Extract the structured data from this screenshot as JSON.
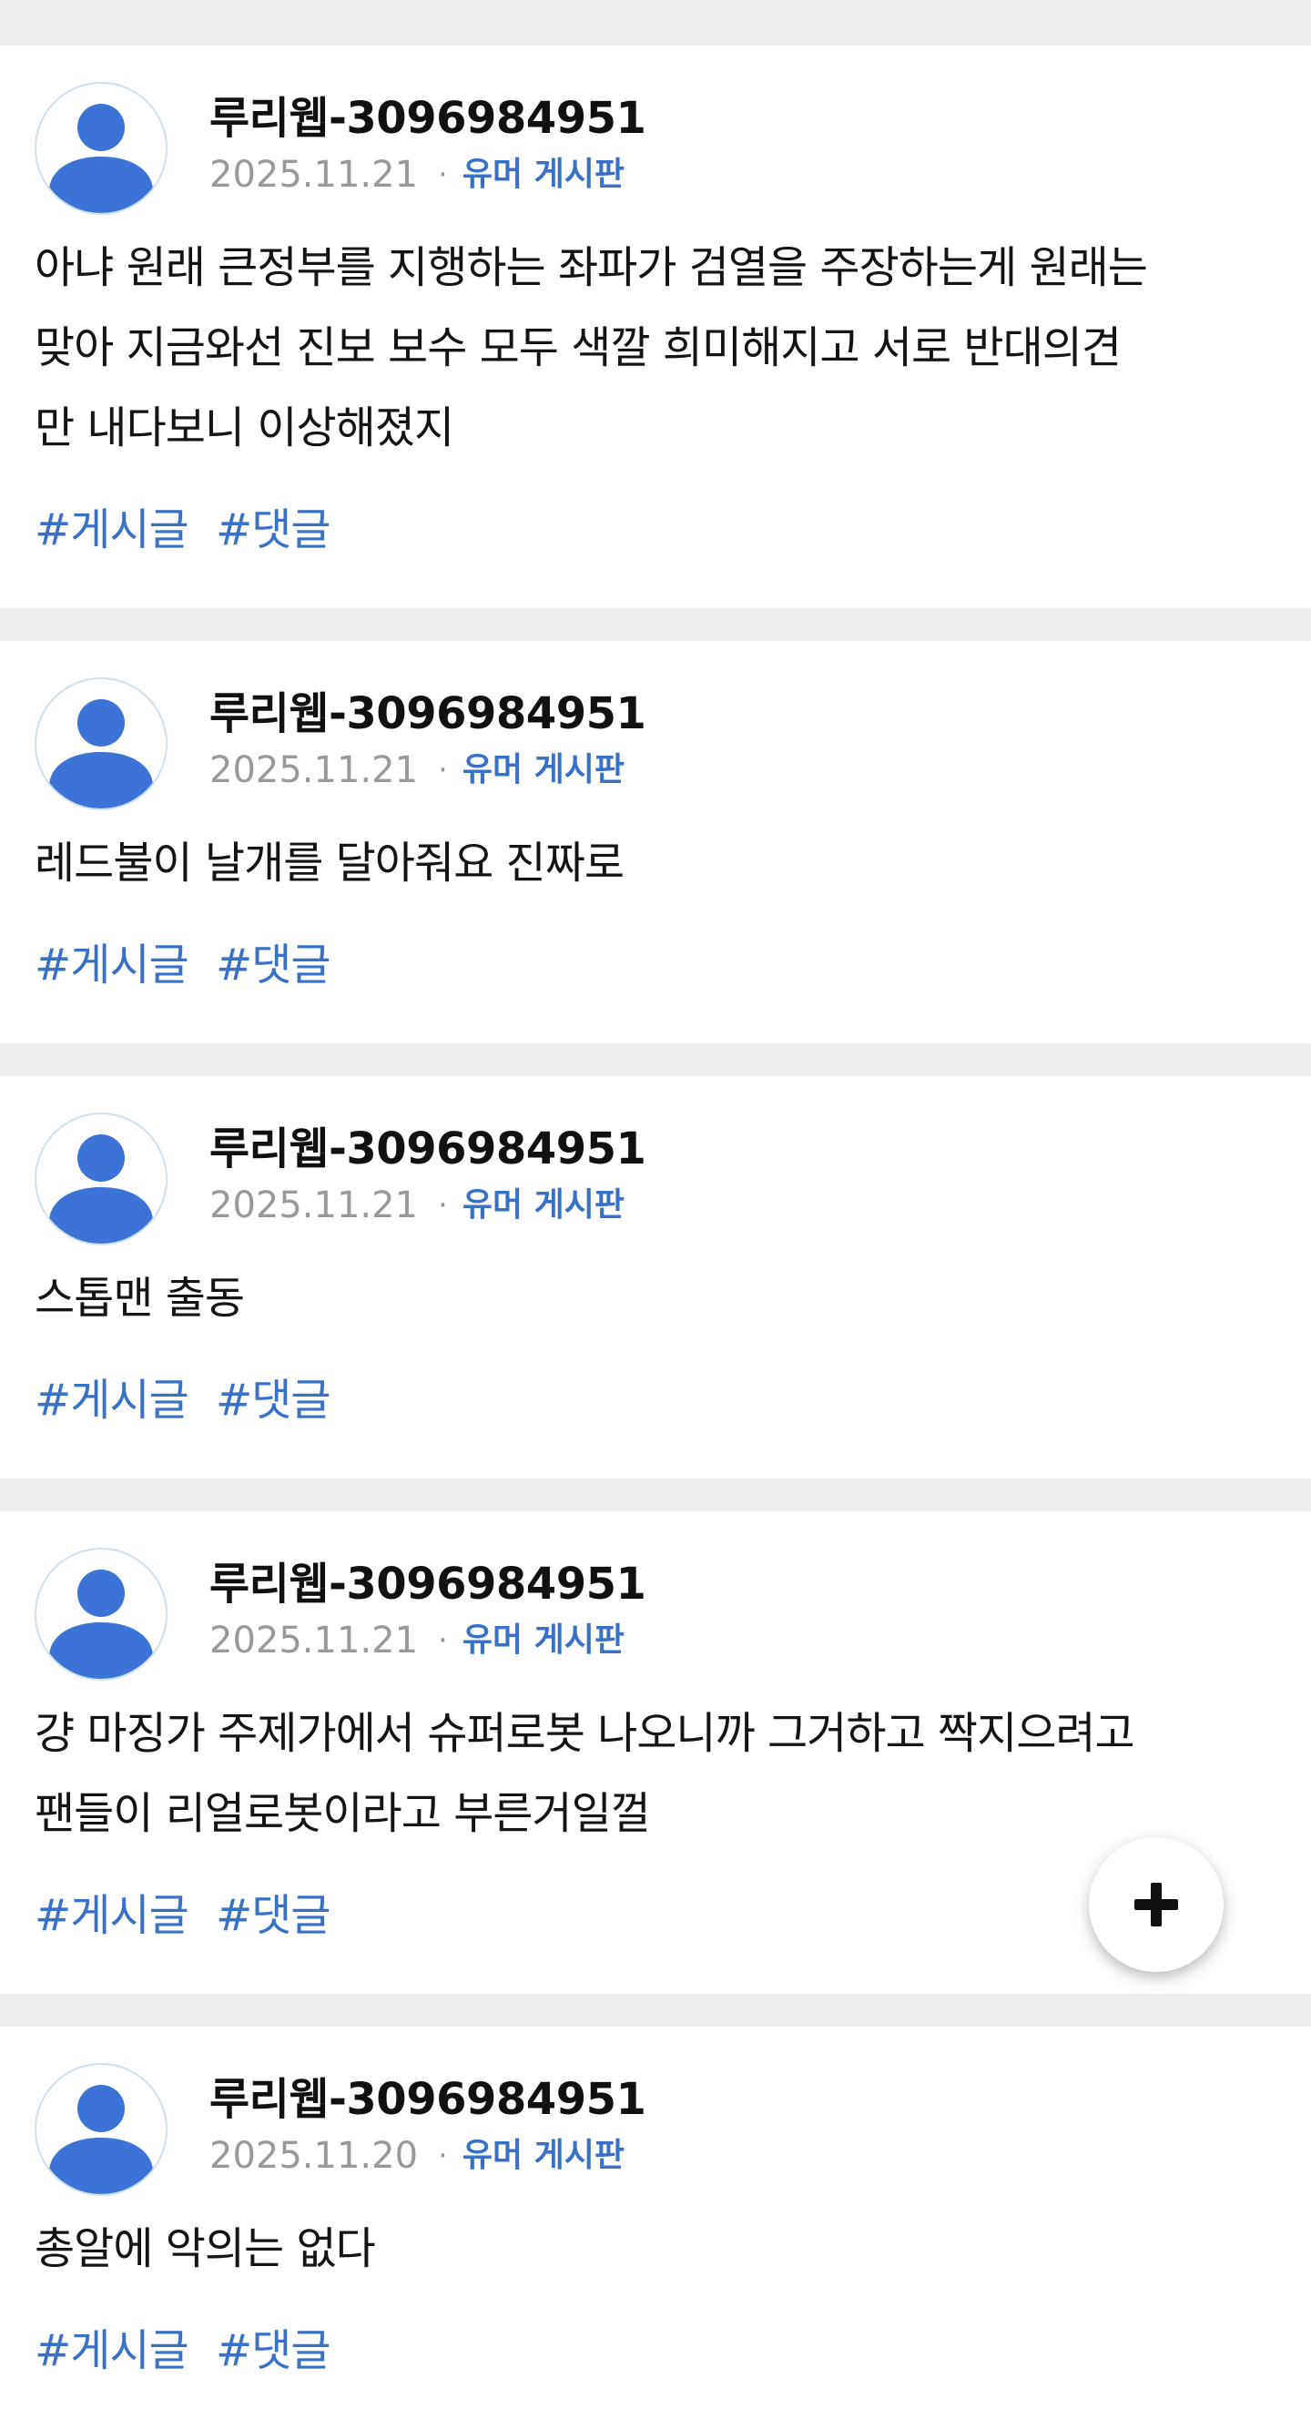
{
  "posts": [
    {
      "author": "루리웹-3096984951",
      "date": "2025.11.21",
      "separator": "·",
      "board": "유머 게시판",
      "lines": [
        "아냐 원래 큰정부를 지행하는 좌파가 검열을 주장하는게 원래는",
        "맞아 지금와선 진보 보수 모두 색깔 희미해지고 서로 반대의견",
        "만 내다보니 이상해졌지"
      ],
      "tags": [
        "#게시글",
        "#댓글"
      ]
    },
    {
      "author": "루리웹-3096984951",
      "date": "2025.11.21",
      "separator": "·",
      "board": "유머 게시판",
      "lines": [
        "레드불이 날개를 달아줘요 진짜로"
      ],
      "tags": [
        "#게시글",
        "#댓글"
      ]
    },
    {
      "author": "루리웹-3096984951",
      "date": "2025.11.21",
      "separator": "·",
      "board": "유머 게시판",
      "lines": [
        "스톱맨 출동"
      ],
      "tags": [
        "#게시글",
        "#댓글"
      ]
    },
    {
      "author": "루리웹-3096984951",
      "date": "2025.11.21",
      "separator": "·",
      "board": "유머 게시판",
      "lines": [
        "걍 마징가 주제가에서 슈퍼로봇 나오니까 그거하고 짝지으려고",
        "팬들이 리얼로봇이라고 부른거일껄"
      ],
      "tags": [
        "#게시글",
        "#댓글"
      ]
    },
    {
      "author": "루리웹-3096984951",
      "date": "2025.11.20",
      "separator": "·",
      "board": "유머 게시판",
      "lines": [
        "총알에 악의는 없다"
      ],
      "tags": [
        "#게시글",
        "#댓글"
      ]
    }
  ],
  "fab": {
    "icon": "plus-icon"
  },
  "colors": {
    "accent": "#3a70c6",
    "avatar": "#3b74d6",
    "background": "#ededed",
    "card": "#ffffff"
  }
}
